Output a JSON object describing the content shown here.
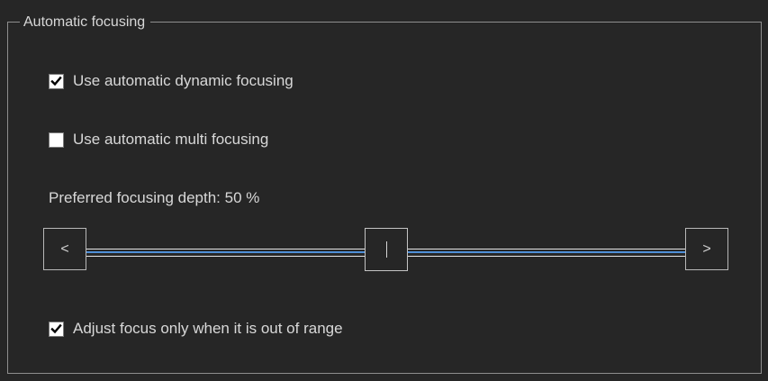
{
  "group": {
    "title": "Automatic focusing"
  },
  "options": {
    "dynamic_focusing": {
      "label": "Use automatic dynamic focusing",
      "checked": true
    },
    "multi_focusing": {
      "label": "Use automatic multi focusing",
      "checked": false
    },
    "adjust_out_of_range": {
      "label": "Adjust focus only when it is out of range",
      "checked": true
    }
  },
  "depth": {
    "label": "Preferred focusing depth: 50 %",
    "value_percent": 50,
    "decrement_glyph": "<",
    "increment_glyph": ">"
  },
  "icons": {
    "checkmark": "checkmark-icon",
    "left": "chevron-left-icon",
    "right": "chevron-right-icon"
  }
}
